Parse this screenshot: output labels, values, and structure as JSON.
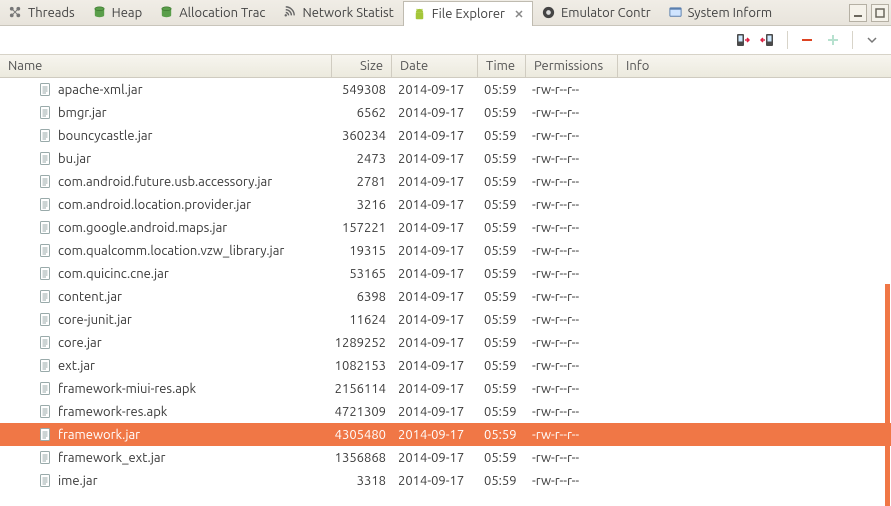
{
  "tabs": [
    {
      "label": "Threads",
      "icon": "threads"
    },
    {
      "label": "Heap",
      "icon": "db"
    },
    {
      "label": "Allocation Trac",
      "icon": "db"
    },
    {
      "label": "Network Statist",
      "icon": "net"
    },
    {
      "label": "File Explorer",
      "icon": "android",
      "active": true,
      "closable": true
    },
    {
      "label": "Emulator Contr",
      "icon": "emu"
    },
    {
      "label": "System Inform",
      "icon": "sys"
    }
  ],
  "columns": {
    "name": "Name",
    "size": "Size",
    "date": "Date",
    "time": "Time",
    "perm": "Permissions",
    "info": "Info"
  },
  "files": [
    {
      "name": "apache-xml.jar",
      "size": "549308",
      "date": "2014-09-17",
      "time": "05:59",
      "perm": "-rw-r--r--"
    },
    {
      "name": "bmgr.jar",
      "size": "6562",
      "date": "2014-09-17",
      "time": "05:59",
      "perm": "-rw-r--r--"
    },
    {
      "name": "bouncycastle.jar",
      "size": "360234",
      "date": "2014-09-17",
      "time": "05:59",
      "perm": "-rw-r--r--"
    },
    {
      "name": "bu.jar",
      "size": "2473",
      "date": "2014-09-17",
      "time": "05:59",
      "perm": "-rw-r--r--"
    },
    {
      "name": "com.android.future.usb.accessory.jar",
      "size": "2781",
      "date": "2014-09-17",
      "time": "05:59",
      "perm": "-rw-r--r--"
    },
    {
      "name": "com.android.location.provider.jar",
      "size": "3216",
      "date": "2014-09-17",
      "time": "05:59",
      "perm": "-rw-r--r--"
    },
    {
      "name": "com.google.android.maps.jar",
      "size": "157221",
      "date": "2014-09-17",
      "time": "05:59",
      "perm": "-rw-r--r--"
    },
    {
      "name": "com.qualcomm.location.vzw_library.jar",
      "size": "19315",
      "date": "2014-09-17",
      "time": "05:59",
      "perm": "-rw-r--r--"
    },
    {
      "name": "com.quicinc.cne.jar",
      "size": "53165",
      "date": "2014-09-17",
      "time": "05:59",
      "perm": "-rw-r--r--"
    },
    {
      "name": "content.jar",
      "size": "6398",
      "date": "2014-09-17",
      "time": "05:59",
      "perm": "-rw-r--r--"
    },
    {
      "name": "core-junit.jar",
      "size": "11624",
      "date": "2014-09-17",
      "time": "05:59",
      "perm": "-rw-r--r--"
    },
    {
      "name": "core.jar",
      "size": "1289252",
      "date": "2014-09-17",
      "time": "05:59",
      "perm": "-rw-r--r--"
    },
    {
      "name": "ext.jar",
      "size": "1082153",
      "date": "2014-09-17",
      "time": "05:59",
      "perm": "-rw-r--r--"
    },
    {
      "name": "framework-miui-res.apk",
      "size": "2156114",
      "date": "2014-09-17",
      "time": "05:59",
      "perm": "-rw-r--r--"
    },
    {
      "name": "framework-res.apk",
      "size": "4721309",
      "date": "2014-09-17",
      "time": "05:59",
      "perm": "-rw-r--r--"
    },
    {
      "name": "framework.jar",
      "size": "4305480",
      "date": "2014-09-17",
      "time": "05:59",
      "perm": "-rw-r--r--",
      "selected": true
    },
    {
      "name": "framework_ext.jar",
      "size": "1356868",
      "date": "2014-09-17",
      "time": "05:59",
      "perm": "-rw-r--r--"
    },
    {
      "name": "ime.jar",
      "size": "3318",
      "date": "2014-09-17",
      "time": "05:59",
      "perm": "-rw-r--r--"
    }
  ]
}
